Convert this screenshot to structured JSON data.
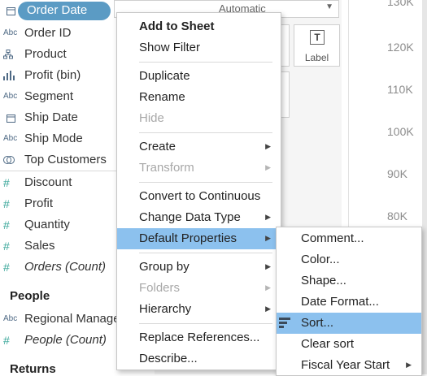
{
  "data_pane": {
    "fields": [
      {
        "label": "Order Date",
        "icon": "calendar-icon",
        "glyph": "🗓",
        "selected": true
      },
      {
        "label": "Order ID",
        "icon": "abc-string-icon",
        "glyph": "Abc"
      },
      {
        "label": "Product",
        "icon": "hierarchy-icon",
        "glyph": "品"
      },
      {
        "label": "Profit (bin)",
        "icon": "histogram-icon",
        "glyph": "ılı"
      },
      {
        "label": "Segment",
        "icon": "abc-string-icon",
        "glyph": "Abc"
      },
      {
        "label": "Ship Date",
        "icon": "calendar-icon",
        "glyph": "🗓"
      },
      {
        "label": "Ship Mode",
        "icon": "abc-string-icon",
        "glyph": "Abc"
      },
      {
        "label": "Top Customers",
        "icon": "set-icon",
        "glyph": "⊚"
      }
    ],
    "measures": [
      {
        "label": "Discount",
        "icon": "number-icon",
        "glyph": "#"
      },
      {
        "label": "Profit",
        "icon": "number-icon",
        "glyph": "#"
      },
      {
        "label": "Quantity",
        "icon": "number-icon",
        "glyph": "#"
      },
      {
        "label": "Sales",
        "icon": "number-icon",
        "glyph": "#"
      },
      {
        "label": "Orders (Count)",
        "icon": "number-icon",
        "glyph": "#",
        "italic": true
      }
    ],
    "people_section": "People",
    "people_fields": [
      {
        "label": "Regional Manager",
        "icon": "abc-string-icon",
        "glyph": "Abc"
      },
      {
        "label": "People (Count)",
        "icon": "number-icon",
        "glyph": "#",
        "italic": true
      }
    ],
    "returns_section": "Returns"
  },
  "marks": {
    "type_select": "Automatic",
    "label_button": "Label",
    "label_icon": "T"
  },
  "axis": {
    "ticks": [
      "130K",
      "120K",
      "110K",
      "100K",
      "90K",
      "80K"
    ]
  },
  "context_menu": {
    "items": [
      {
        "label": "Add to Sheet",
        "bold": true
      },
      {
        "label": "Show Filter"
      },
      {
        "label": "Duplicate"
      },
      {
        "label": "Rename"
      },
      {
        "label": "Hide",
        "disabled": true
      },
      {
        "label": "Create",
        "submenu": true
      },
      {
        "label": "Transform",
        "submenu": true,
        "disabled": true
      },
      {
        "label": "Convert to Continuous"
      },
      {
        "label": "Change Data Type",
        "submenu": true
      },
      {
        "label": "Default Properties",
        "submenu": true,
        "highlighted": true
      },
      {
        "label": "Group by",
        "submenu": true
      },
      {
        "label": "Folders",
        "submenu": true,
        "disabled": true
      },
      {
        "label": "Hierarchy",
        "submenu": true
      },
      {
        "label": "Replace References..."
      },
      {
        "label": "Describe..."
      }
    ]
  },
  "submenu": {
    "items": [
      {
        "label": "Comment..."
      },
      {
        "label": "Color..."
      },
      {
        "label": "Shape..."
      },
      {
        "label": "Date Format..."
      },
      {
        "label": "Sort...",
        "highlighted": true,
        "icon": "sort-icon"
      },
      {
        "label": "Clear sort"
      },
      {
        "label": "Fiscal Year Start",
        "submenu": true
      }
    ]
  },
  "colors": {
    "selected_pill": "#5b9bc4",
    "menu_highlight": "#8cc1ee",
    "measure_icon": "#3aa79a"
  }
}
